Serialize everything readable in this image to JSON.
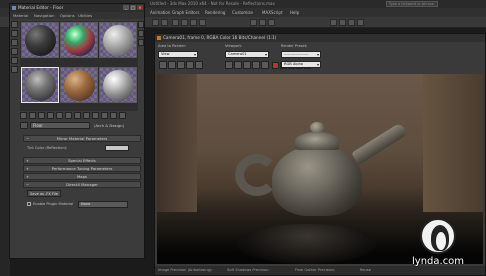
{
  "app": {
    "title": "Untitled - 3ds Max 2010 x64 - Not for Resale - Reflections.max",
    "search_placeholder": "Type a keyword or phrase",
    "menus": [
      "Animation",
      "Graph Editors",
      "Rendering",
      "Customize",
      "MAXScript",
      "Help"
    ]
  },
  "material_editor": {
    "title": "Material Editor - Floor",
    "menus": [
      "Material",
      "Navigation",
      "Options",
      "Utilities"
    ],
    "material_name": "Floor",
    "material_type": "(Arch & Design)",
    "rollouts": {
      "mirror_params": "Mirror Material Parameters",
      "special_effects": "Special Effects",
      "performance": "Performance Tuning Parameters",
      "maps": "Maps",
      "directx": "DirectX Manager"
    },
    "tint_label": "Tint Color (Reflection):",
    "save_fx_label": "Save as .FX File",
    "enable_plugin_label": "Enable Plugin Material",
    "plugin_value": "None"
  },
  "render_window": {
    "title": "Camera01, frame 0, RGBA Color 16 Bits/Channel (1:1)",
    "area_label": "Area to Render:",
    "area_value": "View",
    "viewport_label": "Viewport:",
    "viewport_value": "Camera01",
    "preset_label": "Render Preset:",
    "preset_value": "-------------------",
    "render_button": "Render",
    "production_label": "Production",
    "channel_value": "RGB Alpha",
    "status": {
      "image_precision": "Image Precision (Antialiasing):",
      "soft_shadows": "Soft Shadows Precision:",
      "final_gather": "Final Gather Precision:",
      "reuse": "Reuse"
    }
  },
  "watermark": {
    "text": "lynda.com"
  }
}
